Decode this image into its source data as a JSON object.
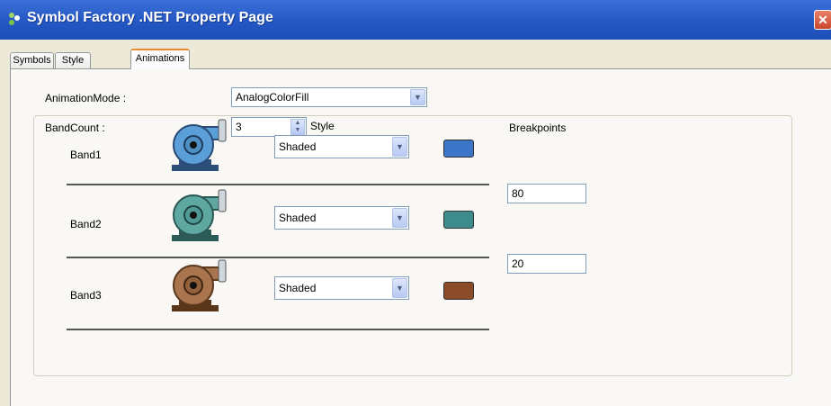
{
  "window": {
    "title": "Symbol Factory .NET Property Page",
    "close_glyph": "✕"
  },
  "tabs": [
    {
      "label": "Symbols",
      "active": false
    },
    {
      "label": "Style",
      "active": false
    },
    {
      "label": "Animations",
      "active": true
    }
  ],
  "animation_mode": {
    "label": "AnimationMode :",
    "value": "AnalogColorFill"
  },
  "band_count": {
    "label": "BandCount :",
    "value": "3"
  },
  "columns": {
    "style": "Style",
    "breakpoints": "Breakpoints"
  },
  "bands": [
    {
      "label": "Band1",
      "style": "Shaded",
      "color": "#3c76c8",
      "pump_color": "#5a9fd8"
    },
    {
      "label": "Band2",
      "style": "Shaded",
      "color": "#3d8c8c",
      "pump_color": "#5fa8a2"
    },
    {
      "label": "Band3",
      "style": "Shaded",
      "color": "#8b4a28",
      "pump_color": "#a9744e"
    }
  ],
  "breakpoints": [
    "80",
    "20"
  ],
  "icons": {
    "title": "symbol-factory-app-icon",
    "dropdown": "chevron-down-icon",
    "spinner": "up-down-spinner-icon",
    "pump": "centrifugal-pump-icon"
  }
}
